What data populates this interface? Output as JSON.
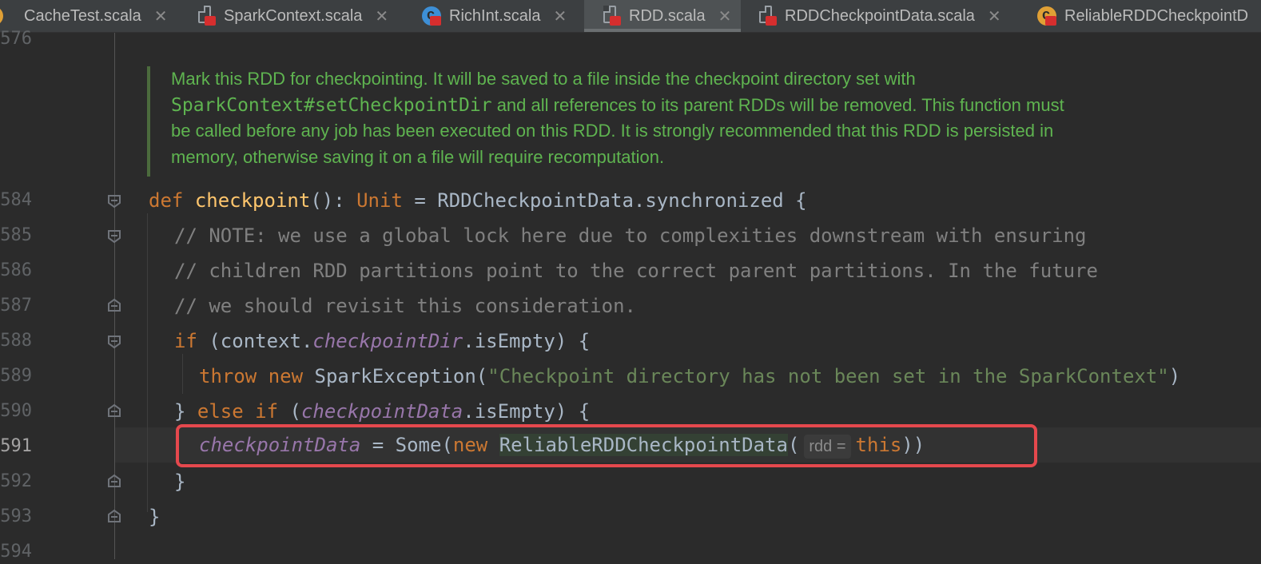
{
  "tabs": [
    {
      "label": "CacheTest.scala",
      "icon": "scala-object-icon",
      "active": false
    },
    {
      "label": "SparkContext.scala",
      "icon": "scala-file-icon",
      "active": false
    },
    {
      "label": "RichInt.scala",
      "icon": "scala-class-icon",
      "active": false
    },
    {
      "label": "RDD.scala",
      "icon": "scala-file-icon",
      "active": true
    },
    {
      "label": "RDDCheckpointData.scala",
      "icon": "scala-file-icon",
      "active": false
    },
    {
      "label": "ReliableRDDCheckpointD",
      "icon": "scala-class-icon",
      "active": false
    }
  ],
  "close_glyph": "✕",
  "line_numbers": [
    "576",
    "584",
    "585",
    "586",
    "587",
    "588",
    "589",
    "590",
    "591",
    "592",
    "593",
    "594"
  ],
  "doc_comment": {
    "line1": "Mark this RDD for checkpointing. It will be saved to a file inside the checkpoint directory set with",
    "line2_code": "SparkContext#setCheckpointDir",
    "line2_rest": " and all references to its parent RDDs will be removed. This function must",
    "line3": "be called before any job has been executed on this RDD. It is strongly recommended that this RDD is persisted in",
    "line4": "memory, otherwise saving it on a file will require recomputation."
  },
  "code": {
    "l584": {
      "kw": "def",
      "fn": "checkpoint",
      "p1": "(): ",
      "typ": "Unit",
      "rest": " = RDDCheckpointData.synchronized {"
    },
    "l585": "// NOTE: we use a global lock here due to complexities downstream with ensuring",
    "l586": "// children RDD partitions point to the correct parent partitions. In the future",
    "l587": "// we should revisit this consideration.",
    "l588": {
      "kw": "if",
      "p1": " (context.",
      "fld": "checkpointDir",
      "rest": ".isEmpty) {"
    },
    "l589": {
      "kw1": "throw",
      "kw2": "new",
      "p1": " SparkException(",
      "str": "\"Checkpoint directory has not been set in the SparkContext\"",
      "rest": ")"
    },
    "l590": {
      "p1": "} ",
      "kw1": "else",
      "kw2": "if",
      "p2": " (",
      "fld": "checkpointData",
      "rest": ".isEmpty) {"
    },
    "l591": {
      "fld": "checkpointData",
      "p1": " = Some(",
      "kw": "new",
      "cls": "ReliableRDDCheckpointData",
      "p2": "(",
      "hint": "rdd =",
      "kw2": "this",
      "rest": "))"
    },
    "l592": "}",
    "l593": "}"
  }
}
